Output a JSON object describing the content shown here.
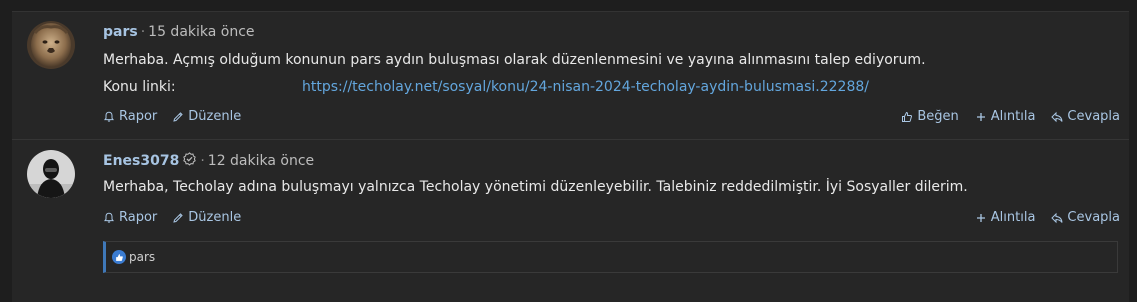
{
  "posts": [
    {
      "author": "pars",
      "time": "15 dakika önce",
      "body_line1": "Merhaba. Açmış olduğum konunun pars aydın buluşması olarak düzenlenmesini ve yayına alınmasını talep ediyorum.",
      "link_label": "Konu linki:",
      "link_url": "https://techolay.net/sosyal/konu/24-nisan-2024-techolay-aydin-bulusmasi.22288/",
      "actions_left": [
        "Rapor",
        "Düzenle"
      ],
      "actions_right": [
        "Beğen",
        "Alıntıla",
        "Cevapla"
      ]
    },
    {
      "author": "Enes3078",
      "time": "12 dakika önce",
      "body_line1": "Merhaba, Techolay adına buluşmayı yalnızca Techolay yönetimi düzenleyebilir. Talebiniz reddedilmiştir. İyi Sosyaller dilerim.",
      "actions_left": [
        "Rapor",
        "Düzenle"
      ],
      "actions_right": [
        "Alıntıla",
        "Cevapla"
      ],
      "reactions_user": "pars"
    }
  ],
  "separator": "·",
  "colors": {
    "accent": "#a7c4e2",
    "link": "#63a6dd",
    "background": "#262626"
  }
}
